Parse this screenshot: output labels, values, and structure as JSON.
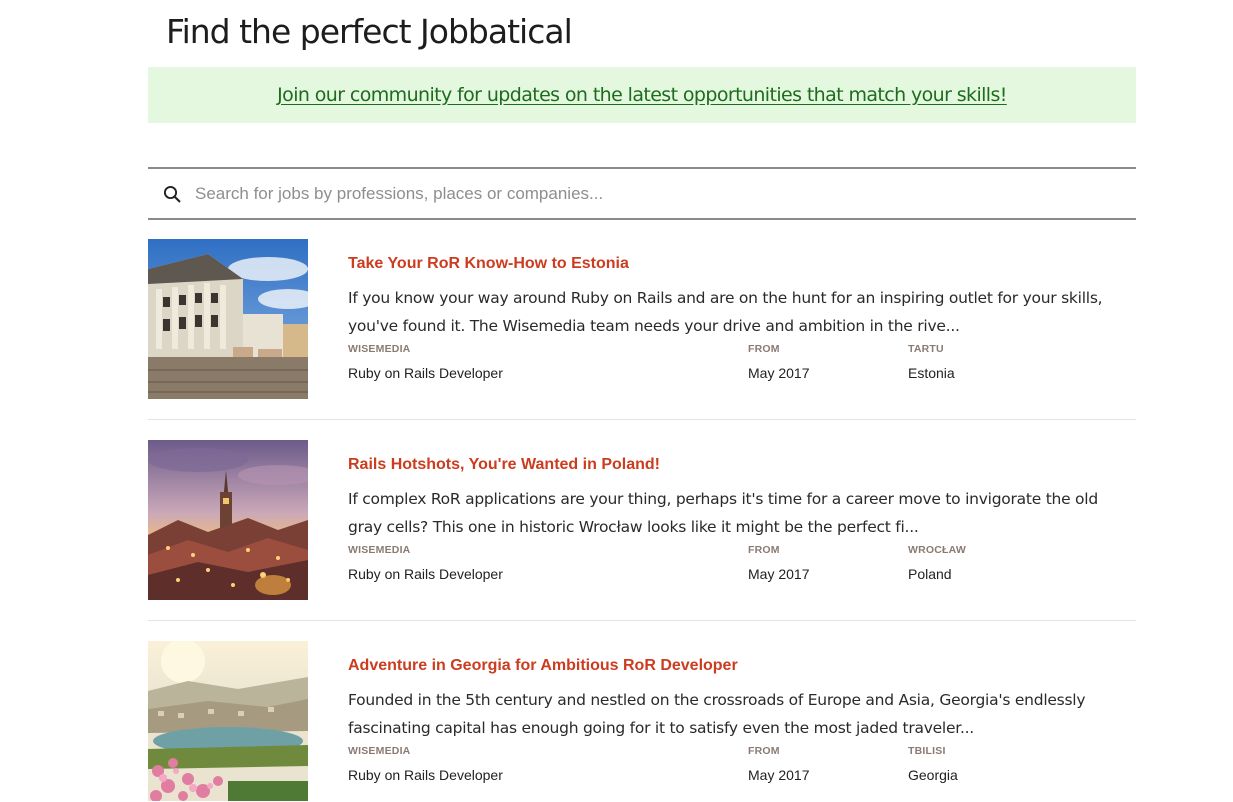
{
  "header": {
    "title": "Find the perfect Jobbatical"
  },
  "banner": {
    "link_text": "Join our community for updates on the latest opportunities that match your skills!"
  },
  "search": {
    "placeholder": "Search for jobs by professions, places or companies...",
    "icon": "search-icon"
  },
  "colors": {
    "title_accent": "#cc3c1f",
    "banner_bg": "#e3f8df",
    "banner_link": "#1d6b1d",
    "meta_label": "#8a7b72"
  },
  "jobs": [
    {
      "title": "Take Your RoR Know-How to Estonia",
      "description": "If you know your way around Ruby on Rails and are on the hunt for an inspiring outlet for your skills, you've found it. The Wisemedia team needs your drive and ambition in the rive...",
      "company_label": "WISEMEDIA",
      "role": "Ruby on Rails Developer",
      "from_label": "FROM",
      "from_value": "May 2017",
      "city_label": "TARTU",
      "country": "Estonia",
      "image": "town-square-photo"
    },
    {
      "title": "Rails Hotshots, You're Wanted in Poland!",
      "description": "If complex RoR applications are your thing, perhaps it's time for a career move to invigorate the old gray cells? This one in historic Wrocław looks like it might be the perfect fi...",
      "company_label": "WISEMEDIA",
      "role": "Ruby on Rails Developer",
      "from_label": "FROM",
      "from_value": "May 2017",
      "city_label": "WROCŁAW",
      "country": "Poland",
      "image": "city-at-dusk-photo"
    },
    {
      "title": "Adventure in Georgia for Ambitious RoR Developer",
      "description": "Founded in the 5th century and nestled on the crossroads of Europe and Asia, Georgia's endlessly fascinating capital has enough going for it to satisfy even the most jaded traveler...",
      "company_label": "WISEMEDIA",
      "role": "Ruby on Rails Developer",
      "from_label": "FROM",
      "from_value": "May 2017",
      "city_label": "TBILISI",
      "country": "Georgia",
      "image": "city-with-flowers-photo"
    }
  ]
}
